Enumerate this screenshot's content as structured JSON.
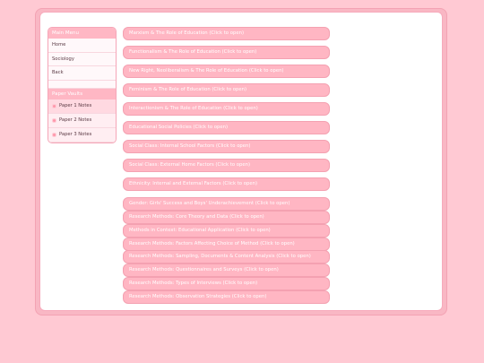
{
  "sidebar": {
    "main_menu_title": "Main Menu",
    "menu_items": [
      {
        "label": "Home"
      },
      {
        "label": "Sociology"
      },
      {
        "label": "Back"
      }
    ],
    "paper_vaults_title": "Paper Vaults",
    "vaults": [
      {
        "label": "Paper 1 Notes"
      },
      {
        "label": "Paper 2 Notes"
      },
      {
        "label": "Paper 3 Notes"
      }
    ]
  },
  "notes": [
    {
      "label": "Marxism & The Role of Education (Click to open)"
    },
    {
      "label": "Functionalism & The Role of Education (Click to open)"
    },
    {
      "label": "New Right, Neoliberalism & The Role of Education (Click to open)"
    },
    {
      "label": "Feminism & The Role of Education (Click to open)"
    },
    {
      "label": "Interactionism & The Role of Education (Click to open)"
    },
    {
      "label": "Educational Social Policies (Click to open)"
    },
    {
      "label": "Social Class: Internal School Factors (Click to open)"
    },
    {
      "label": "Social Class: External Home Factors (Click to open)"
    },
    {
      "label": "Ethnicity: Internal and External Factors (Click to open)"
    },
    {
      "label": "Gender: Girls' Success and Boys' Underachievement (Click to open)"
    },
    {
      "label": "Research Methods: Core Theory and Data (Click to open)"
    },
    {
      "label": "Methods in Context: Educational Application (Click to open)"
    },
    {
      "label": "Research Methods: Factors Affecting Choice of Method (Click to open)"
    },
    {
      "label": "Research Methods: Sampling, Documents & Content Analysis (Click to open)"
    },
    {
      "label": "Research Methods: Questionnaires and Surveys (Click to open)"
    },
    {
      "label": "Research Methods: Types of Interviews (Click to open)"
    },
    {
      "label": "Research Methods: Observation Strategies (Click to open)"
    }
  ],
  "colors": {
    "page_bg": "#ffc9d3",
    "accent": "#ffb6c3",
    "panel_bg": "#ffffff"
  }
}
